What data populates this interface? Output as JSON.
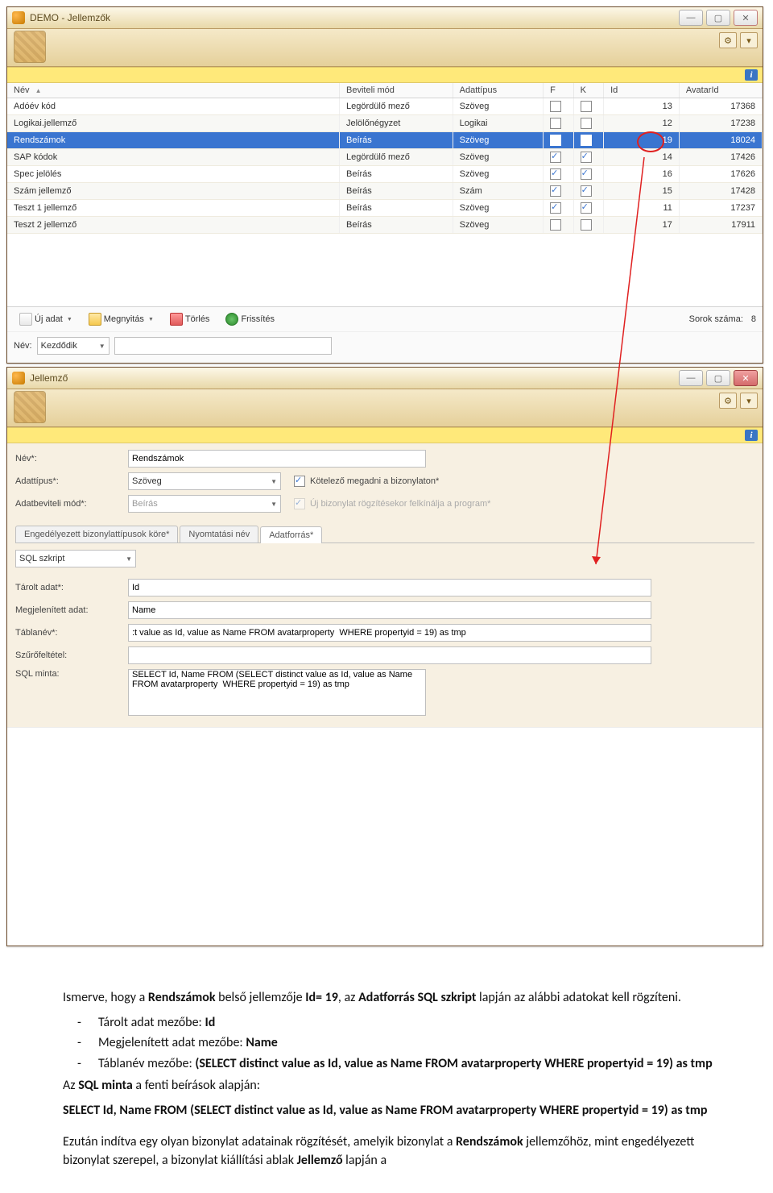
{
  "win1": {
    "title": "DEMO - Jellemzők",
    "columns": [
      "Név",
      "Beviteli mód",
      "Adattípus",
      "F",
      "K",
      "Id",
      "AvatarId"
    ],
    "rows": [
      {
        "nev": "Adóév kód",
        "bev": "Legördülő mező",
        "tip": "Szöveg",
        "f": false,
        "k": false,
        "id": "13",
        "av": "17368",
        "sel": false
      },
      {
        "nev": "Logikai.jellemző",
        "bev": "Jelölőnégyzet",
        "tip": "Logikai",
        "f": false,
        "k": false,
        "id": "12",
        "av": "17238",
        "sel": false
      },
      {
        "nev": "Rendszámok",
        "bev": "Beírás",
        "tip": "Szöveg",
        "f": true,
        "k": true,
        "id": "19",
        "av": "18024",
        "sel": true
      },
      {
        "nev": "SAP kódok",
        "bev": "Legördülő mező",
        "tip": "Szöveg",
        "f": true,
        "k": true,
        "id": "14",
        "av": "17426",
        "sel": false
      },
      {
        "nev": "Spec jelölés",
        "bev": "Beírás",
        "tip": "Szöveg",
        "f": true,
        "k": true,
        "id": "16",
        "av": "17626",
        "sel": false
      },
      {
        "nev": "Szám jellemző",
        "bev": "Beírás",
        "tip": "Szám",
        "f": true,
        "k": true,
        "id": "15",
        "av": "17428",
        "sel": false
      },
      {
        "nev": "Teszt 1 jellemző",
        "bev": "Beírás",
        "tip": "Szöveg",
        "f": true,
        "k": true,
        "id": "11",
        "av": "17237",
        "sel": false
      },
      {
        "nev": "Teszt 2 jellemző",
        "bev": "Beírás",
        "tip": "Szöveg",
        "f": false,
        "k": false,
        "id": "17",
        "av": "17911",
        "sel": false
      }
    ],
    "toolbar": {
      "new": "Új adat",
      "open": "Megnyitás",
      "del": "Törlés",
      "refresh": "Frissítés",
      "rowcount_label": "Sorok száma:",
      "rowcount": "8"
    },
    "filter": {
      "label": "Név:",
      "mode": "Kezdődik"
    }
  },
  "win2": {
    "title": "Jellemző",
    "labels": {
      "nev": "Név*:",
      "adattipus": "Adattípus*:",
      "bevmod": "Adatbeviteli mód*:",
      "kotelezo": "Kötelező megadni a bizonylaton*",
      "ujbiz": "Új bizonylat rögzítésekor felkínálja a program*"
    },
    "values": {
      "nev": "Rendszámok",
      "adattipus": "Szöveg",
      "bevmod": "Beírás",
      "kotelezo": true,
      "ujbiz": true
    },
    "tabs": {
      "t1": "Engedélyezett bizonylattípusok köre*",
      "t2": "Nyomtatási név",
      "t3": "Adatforrás*"
    },
    "adatforras": {
      "combo_label": "SQL szkript",
      "tarolt_label": "Tárolt adat*:",
      "tarolt": "Id",
      "megjel_label": "Megjelenített adat:",
      "megjel": "Name",
      "tablanev_label": "Táblanév*:",
      "tablanev": ":t value as Id, value as Name FROM avatarproperty  WHERE propertyid = 19) as tmp",
      "szuro_label": "Szűrőfeltétel:",
      "szuro": "",
      "minta_label": "SQL minta:",
      "minta": "SELECT Id, Name FROM (SELECT distinct value as Id, value as Name FROM avatarproperty  WHERE propertyid = 19) as tmp"
    }
  },
  "doc": {
    "p1a": "Ismerve, hogy a ",
    "p1b": "Rendszámok",
    "p1c": " belső jellemzője ",
    "p1d": "Id= 19",
    "p1e": ", az ",
    "p1f": "Adatforrás SQL szkript",
    "p1g": " lapján az alábbi adatokat kell rögzíteni.",
    "li1a": "Tárolt adat mezőbe: ",
    "li1b": "Id",
    "li2a": "Megjelenített adat mezőbe: ",
    "li2b": "Name",
    "li3a": "Táblanév mezőbe: ",
    "li3b": "(SELECT distinct value as Id, value as Name FROM avatarproperty WHERE propertyid = 19) as tmp",
    "p2a": "Az ",
    "p2b": "SQL minta",
    "p2c": " a fenti beírások alapján:",
    "p3": "SELECT Id, Name FROM (SELECT distinct value as Id, value as Name FROM avatarproperty  WHERE propertyid = 19) as tmp",
    "p4a": "Ezután indítva egy olyan bizonylat adatainak rögzítését, amelyik bizonylat a ",
    "p4b": "Rendszámok",
    "p4c": " jellemzőhöz, mint engedélyezett bizonylat szerepel, a bizonylat kiállítási ablak ",
    "p4d": "Jellemző",
    "p4e": " lapján a"
  }
}
